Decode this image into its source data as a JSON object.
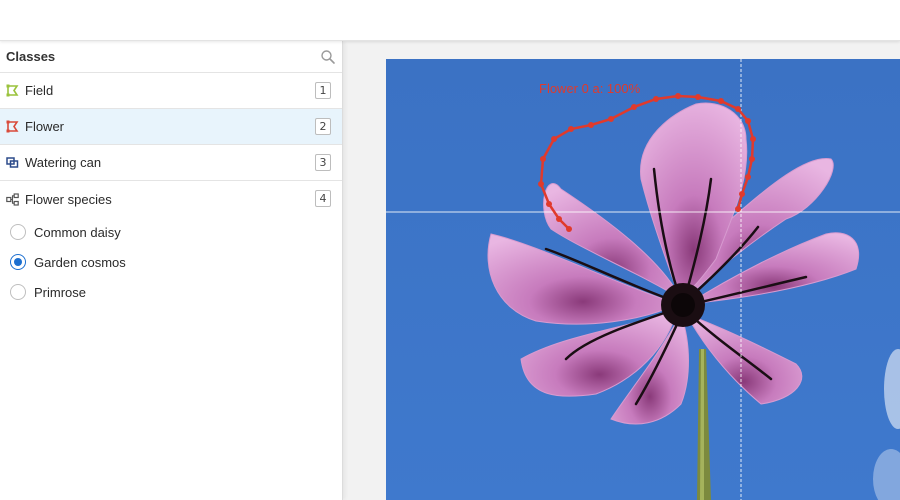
{
  "sidebar": {
    "title": "Classes",
    "classes": [
      {
        "label": "Field",
        "hotkey": "1",
        "icon": "bounding-box-icon"
      },
      {
        "label": "Flower",
        "hotkey": "2",
        "icon": "polygon-icon"
      },
      {
        "label": "Watering can",
        "hotkey": "3",
        "icon": "cuboid-icon"
      },
      {
        "label": "Flower species",
        "hotkey": "4",
        "icon": "tag-tree-icon"
      }
    ],
    "options": [
      {
        "label": "Common daisy"
      },
      {
        "label": "Garden cosmos"
      },
      {
        "label": "Primrose"
      }
    ]
  },
  "canvas": {
    "annotation_label": "Flower 0 a: 100%"
  },
  "colors": {
    "field": "#9ac23c",
    "flower": "#d94a3a",
    "watering_can": "#2c4a8a",
    "species": "#555555",
    "annotation": "#e03a2c",
    "sky": "#3a74c8",
    "selected_row": "#e8f4fc"
  }
}
